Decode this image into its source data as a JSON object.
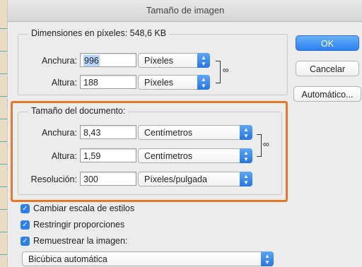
{
  "window": {
    "title": "Tamaño de imagen"
  },
  "pixel_dimensions": {
    "legend": "Dimensiones en píxeles: 548,6 KB",
    "width_label": "Anchura:",
    "width_value": "996",
    "width_unit": "Píxeles",
    "height_label": "Altura:",
    "height_value": "188",
    "height_unit": "Píxeles"
  },
  "document_size": {
    "legend": "Tamaño del documento:",
    "width_label": "Anchura:",
    "width_value": "8,43",
    "width_unit": "Centímetros",
    "height_label": "Altura:",
    "height_value": "1,59",
    "height_unit": "Centímetros",
    "resolution_label": "Resolución:",
    "resolution_value": "300",
    "resolution_unit": "Píxeles/pulgada"
  },
  "buttons": {
    "ok": "OK",
    "cancel": "Cancelar",
    "auto": "Automático..."
  },
  "options": {
    "scale_styles": "Cambiar escala de estilos",
    "constrain": "Restringir proporciones",
    "resample": "Remuestrear la imagen:",
    "resample_method": "Bicúbica automática"
  },
  "colors": {
    "highlight": "#e8772a",
    "accent": "#2f7fe8"
  }
}
